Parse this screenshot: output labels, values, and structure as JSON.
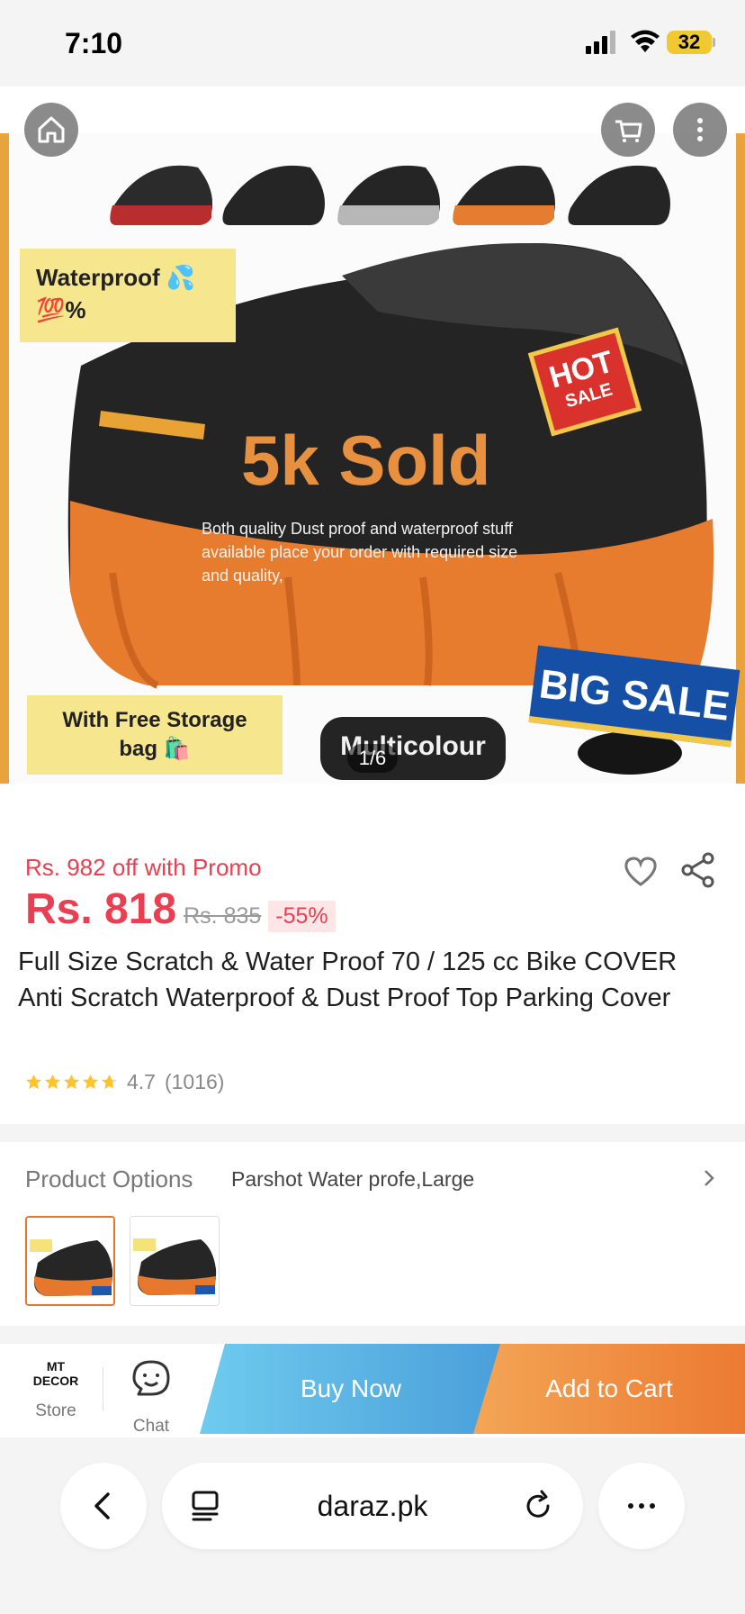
{
  "status_bar": {
    "time": "7:10",
    "battery": "32"
  },
  "hero": {
    "image_counter": "1/6",
    "variant_text": "Multicolour",
    "waterproof_line_1": "Waterproof 💦",
    "waterproof_line_2": "💯%",
    "sold_text": "5k Sold",
    "description_line_1": "Both quality Dust proof and waterproof stuff",
    "description_line_2": "available place your order with required size",
    "description_line_3": "and quality,",
    "hot_line_1": "HOT",
    "hot_line_2": "SALE",
    "big_sale": "BIG SALE",
    "storage_line_1": "With Free Storage",
    "storage_line_2": "bag 🛍️"
  },
  "product": {
    "promo_text": "Rs. 982 off with Promo",
    "price": "Rs. 818",
    "old_price": "Rs. 835",
    "discount": "-55%",
    "title": "Full Size Scratch & Water Proof 70 / 125 cc Bike COVER Anti Scratch Waterproof & Dust Proof Top Parking Cover",
    "rating": "4.7",
    "review_count": "(1016)",
    "rating_value": 4.7
  },
  "options": {
    "label": "Product Options",
    "selected_value": "Parshot Water profe,Large"
  },
  "bottom_bar": {
    "store_logo": "MT DECOR",
    "store_label": "Store",
    "chat_label": "Chat",
    "buy_now": "Buy Now",
    "add_to_cart": "Add to Cart"
  },
  "browser": {
    "url": "daraz.pk"
  },
  "colors": {
    "price_red": "#e84052",
    "buy_now_blue": "#4a9fda",
    "add_to_cart_orange": "#ec7a32",
    "hero_orange": "#e7903f"
  }
}
